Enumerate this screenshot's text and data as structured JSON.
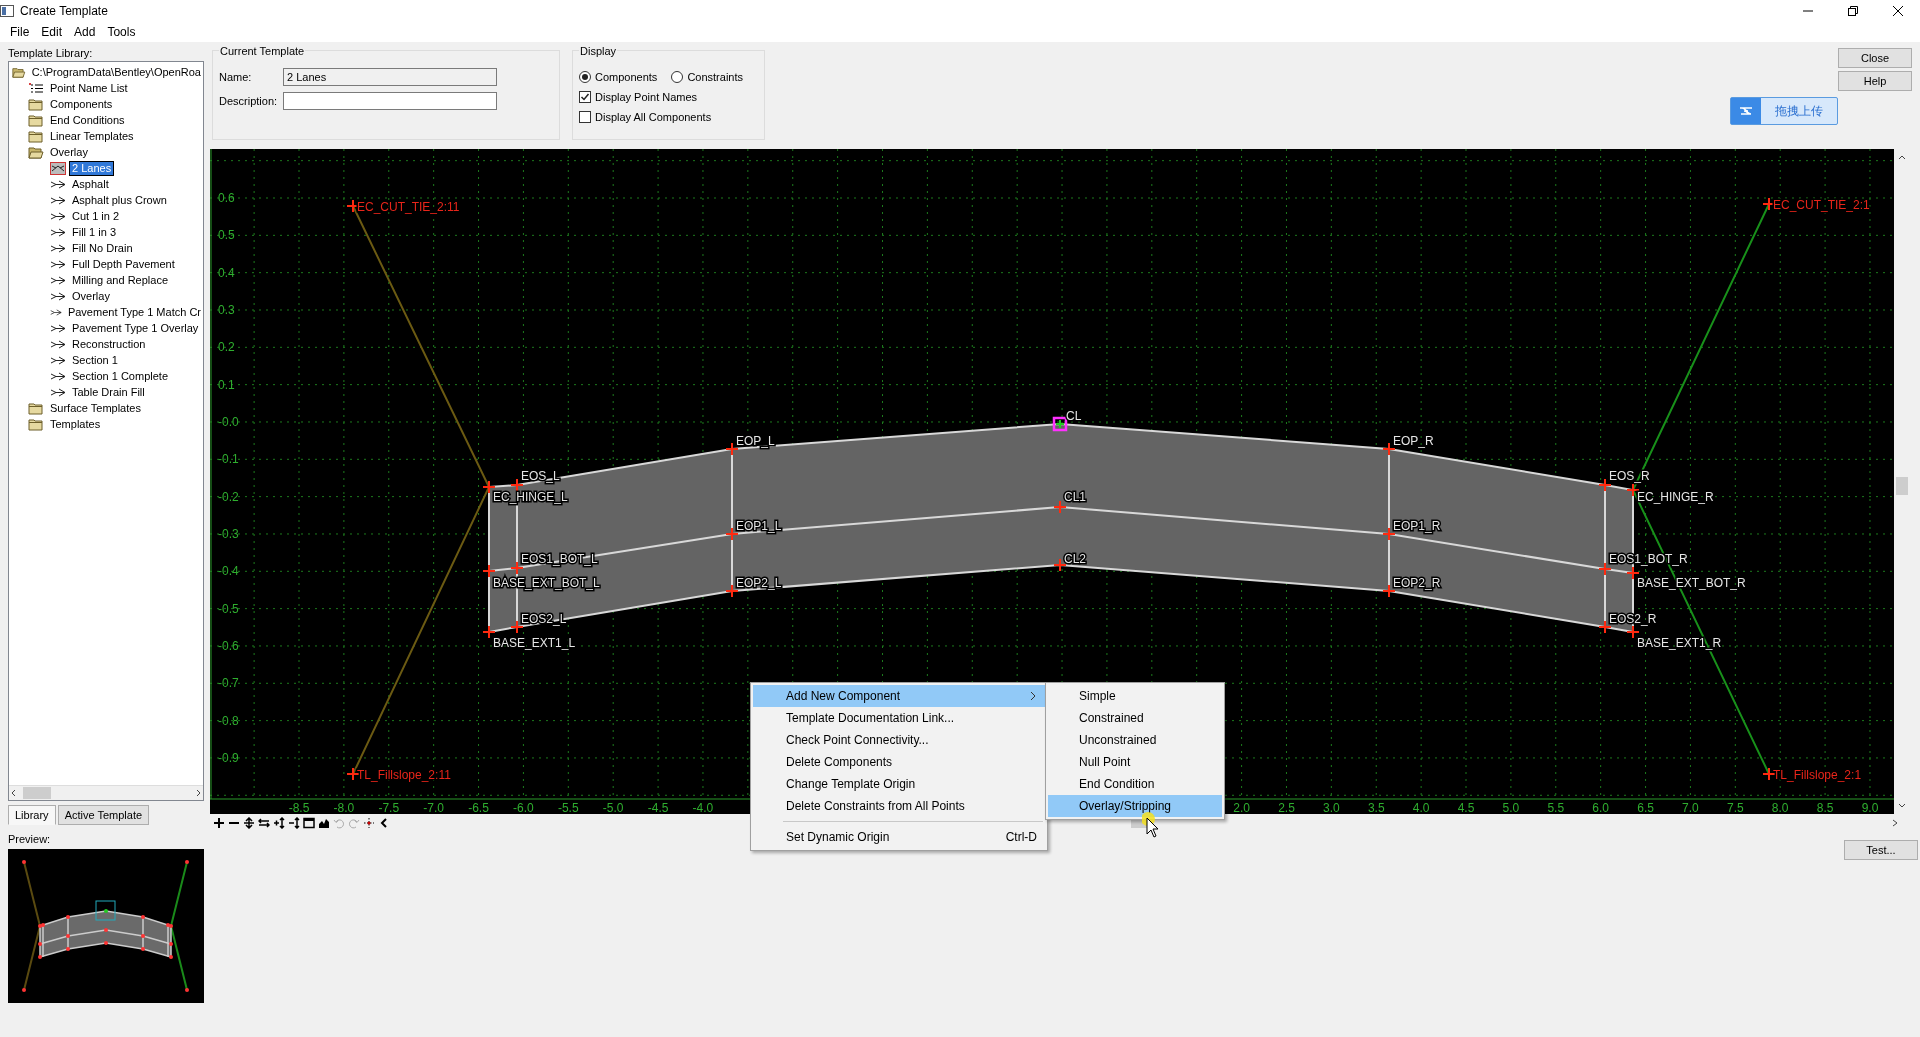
{
  "window": {
    "title": "Create Template"
  },
  "menu_bar": [
    "File",
    "Edit",
    "Add",
    "Tools"
  ],
  "library": {
    "label": "Template Library:",
    "tree": [
      {
        "label": "C:\\ProgramData\\Bentley\\OpenRoa",
        "kind": "folder",
        "expanded": true,
        "selected": false,
        "children": [
          {
            "label": "Point Name List",
            "kind": "list",
            "selected": false
          },
          {
            "label": "Components",
            "kind": "folder",
            "expanded": false,
            "selected": false
          },
          {
            "label": "End Conditions",
            "kind": "folder",
            "expanded": false,
            "selected": false
          },
          {
            "label": "Linear Templates",
            "kind": "folder",
            "expanded": false,
            "selected": false
          },
          {
            "label": "Overlay",
            "kind": "folder",
            "expanded": true,
            "selected": false,
            "children": [
              {
                "label": "2 Lanes",
                "kind": "template",
                "selected": true
              },
              {
                "label": "Asphalt",
                "kind": "template",
                "selected": false
              },
              {
                "label": "Asphalt plus Crown",
                "kind": "template",
                "selected": false
              },
              {
                "label": "Cut 1 in 2",
                "kind": "template",
                "selected": false
              },
              {
                "label": "Fill 1 in 3",
                "kind": "template",
                "selected": false
              },
              {
                "label": "Fill No Drain",
                "kind": "template",
                "selected": false
              },
              {
                "label": "Full Depth Pavement",
                "kind": "template",
                "selected": false
              },
              {
                "label": "Milling and Replace",
                "kind": "template",
                "selected": false
              },
              {
                "label": "Overlay",
                "kind": "template",
                "selected": false
              },
              {
                "label": "Pavement Type 1 Match Cr",
                "kind": "template",
                "selected": false
              },
              {
                "label": "Pavement Type 1 Overlay",
                "kind": "template",
                "selected": false
              },
              {
                "label": "Reconstruction",
                "kind": "template",
                "selected": false
              },
              {
                "label": "Section 1",
                "kind": "template",
                "selected": false
              },
              {
                "label": "Section 1 Complete",
                "kind": "template",
                "selected": false
              },
              {
                "label": "Table Drain Fill",
                "kind": "template",
                "selected": false
              }
            ]
          },
          {
            "label": "Surface Templates",
            "kind": "folder",
            "expanded": false,
            "selected": false
          },
          {
            "label": "Templates",
            "kind": "folder",
            "expanded": false,
            "selected": false
          }
        ]
      }
    ]
  },
  "tabs": [
    {
      "label": "Library",
      "selected": true
    },
    {
      "label": "Active Template",
      "selected": false
    }
  ],
  "preview": {
    "label": "Preview:"
  },
  "current_template": {
    "title": "Current Template",
    "fields": [
      {
        "label": "Name:",
        "value": "2 Lanes",
        "readonly": true
      },
      {
        "label": "Description:",
        "readonly": false
      }
    ]
  },
  "display": {
    "title": "Display",
    "options": [
      {
        "kind": "radio",
        "label": "Components",
        "selected": true
      },
      {
        "kind": "radio",
        "label": "Constraints",
        "selected": false
      },
      {
        "kind": "checkbox",
        "label": "Display Point Names",
        "checked": true
      },
      {
        "kind": "checkbox",
        "label": "Display All Components",
        "checked": false
      }
    ]
  },
  "buttons": [
    "Close",
    "Help"
  ],
  "upload_button": "拖拽上传",
  "test_button": "Test...",
  "canvas": {
    "y_labels": [
      "0.6",
      "0.5",
      "0.4",
      "0.3",
      "0.2",
      "0.1",
      "-0.0",
      "-0.1",
      "-0.2",
      "-0.3",
      "-0.4",
      "-0.5",
      "-0.6",
      "-0.7",
      "-0.8",
      "-0.9"
    ],
    "x_labels": [
      "-8.5",
      "-8.0",
      "-7.5",
      "-7.0",
      "-6.5",
      "-6.0",
      "-5.5",
      "-5.0",
      "-4.5",
      "-4.0",
      "2.0",
      "2.5",
      "3.0",
      "3.5",
      "4.0",
      "4.5",
      "5.0",
      "5.5",
      "6.0",
      "6.5",
      "7.0",
      "7.5",
      "8.0",
      "8.5",
      "9.0"
    ],
    "points": [
      {
        "name": "EC_CUT_TIE_2:11",
        "kind": "end_condition",
        "origin": false
      },
      {
        "name": "EC_CUT_TIE_2:1",
        "kind": "end_condition",
        "origin": false
      },
      {
        "name": "CL",
        "kind": "component",
        "origin": true
      },
      {
        "name": "EOP_L",
        "kind": "component",
        "origin": false
      },
      {
        "name": "EOP_R",
        "kind": "component",
        "origin": false
      },
      {
        "name": "EOS_L",
        "kind": "component",
        "origin": false
      },
      {
        "name": "EOS_R",
        "kind": "component",
        "origin": false
      },
      {
        "name": "EC_HINGE_L",
        "kind": "component",
        "origin": false
      },
      {
        "name": "CL1",
        "kind": "component",
        "origin": false
      },
      {
        "name": "EC_HINGE_R",
        "kind": "component",
        "origin": false
      },
      {
        "name": "EOP1_L",
        "kind": "component",
        "origin": false
      },
      {
        "name": "EOP1_R",
        "kind": "component",
        "origin": false
      },
      {
        "name": "EOS1_BOT_L",
        "kind": "component",
        "origin": false
      },
      {
        "name": "CL2",
        "kind": "component",
        "origin": false
      },
      {
        "name": "EOS1_BOT_R",
        "kind": "component",
        "origin": false
      },
      {
        "name": "BASE_EXT_BOT_L",
        "kind": "component",
        "origin": false
      },
      {
        "name": "EOP2_L",
        "kind": "component",
        "origin": false
      },
      {
        "name": "EOP2_R",
        "kind": "component",
        "origin": false
      },
      {
        "name": "BASE_EXT_BOT_R",
        "kind": "component",
        "origin": false
      },
      {
        "name": "EOS2_L",
        "kind": "component",
        "origin": false
      },
      {
        "name": "BASE_EXT1_L",
        "kind": "component",
        "origin": false
      },
      {
        "name": "EOS2_R",
        "kind": "component",
        "origin": false
      },
      {
        "name": "BASE_EXT1_R",
        "kind": "component",
        "origin": false
      },
      {
        "name": "TL_Fillslope_2:11",
        "kind": "end_condition",
        "origin": false
      },
      {
        "name": "TL_Fillslope_2:1",
        "kind": "end_condition",
        "origin": false
      }
    ]
  },
  "context_menu": {
    "items": [
      {
        "label": "Add New Component",
        "selected": true,
        "has_submenu": true,
        "separator_before": false
      },
      {
        "label": "Template Documentation Link...",
        "selected": false,
        "has_submenu": false,
        "separator_before": false
      },
      {
        "label": "Check Point Connectivity...",
        "selected": false,
        "has_submenu": false,
        "separator_before": false
      },
      {
        "label": "Delete Components",
        "selected": false,
        "has_submenu": false,
        "separator_before": false
      },
      {
        "label": "Change Template Origin",
        "selected": false,
        "has_submenu": false,
        "separator_before": false
      },
      {
        "label": "Delete Constraints from All Points",
        "selected": false,
        "has_submenu": false,
        "separator_before": false
      },
      {
        "label": "Set Dynamic Origin",
        "shortcut": "Ctrl-D",
        "selected": false,
        "has_submenu": false,
        "separator_before": true
      }
    ],
    "submenu": [
      {
        "label": "Simple",
        "selected": false
      },
      {
        "label": "Constrained",
        "selected": false
      },
      {
        "label": "Unconstrained",
        "selected": false
      },
      {
        "label": "Null Point",
        "selected": false
      },
      {
        "label": "End Condition",
        "selected": false
      },
      {
        "label": "Overlay/Stripping",
        "selected": true
      }
    ]
  }
}
